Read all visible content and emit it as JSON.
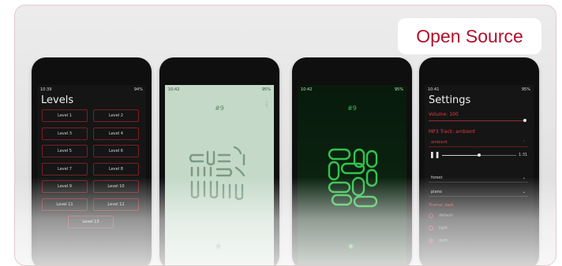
{
  "badge": {
    "label": "Open Source"
  },
  "phone1": {
    "status": {
      "time": "10:39",
      "battery": "94%"
    },
    "title": "Levels",
    "levels": [
      "Level 1",
      "Level 2",
      "Level 3",
      "Level 4",
      "Level 5",
      "Level 6",
      "Level 7",
      "Level 8",
      "Level 9",
      "Level 10",
      "Level 11",
      "Level 12",
      "Level 13"
    ]
  },
  "phone2": {
    "status": {
      "time": "10:42",
      "battery": "95%"
    },
    "level_number": "#9",
    "colors": {
      "background": "#c4d9c8",
      "stroke": "#7a9a80"
    }
  },
  "phone3": {
    "status": {
      "time": "10:42",
      "battery": "95%"
    },
    "level_number": "#9",
    "colors": {
      "background": "#0a1c0e",
      "stroke": "#33c24f"
    }
  },
  "phone4": {
    "status": {
      "time": "10:41",
      "battery": "95%"
    },
    "title": "Settings",
    "volume_label": "Volume: 100",
    "volume_value": 100,
    "mp3_label": "MP3 Track: ambient",
    "track_select": "ambient",
    "player": {
      "time": "1:31",
      "progress": 0.5
    },
    "select_1": "forest",
    "select_2": "piano",
    "theme_label": "Theme: dark",
    "theme_options": [
      "default",
      "light",
      "dark"
    ],
    "theme_selected": "dark"
  },
  "icons": [
    "overflow-menu-icon",
    "camera-icon",
    "pause-icon",
    "chevron-down-icon",
    "chevron-up-icon",
    "wifi-icon",
    "signal-icon"
  ]
}
